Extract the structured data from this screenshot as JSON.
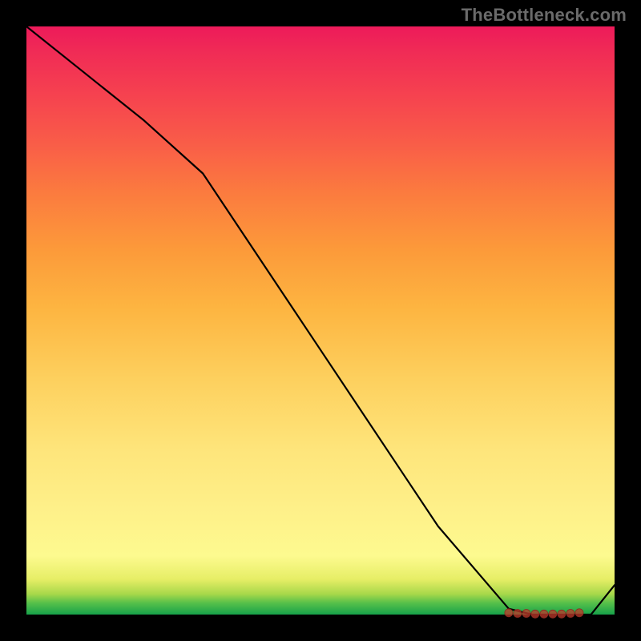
{
  "watermark": "TheBottleneck.com",
  "chart_data": {
    "type": "line",
    "title": "",
    "xlabel": "",
    "ylabel": "",
    "x": [
      0.0,
      0.1,
      0.2,
      0.3,
      0.5,
      0.7,
      0.82,
      0.86,
      0.9,
      0.93,
      0.96,
      1.0
    ],
    "values": [
      1.0,
      0.92,
      0.84,
      0.75,
      0.45,
      0.15,
      0.01,
      0.0,
      0.0,
      0.0,
      0.0,
      0.05
    ],
    "series": [
      {
        "name": "curve",
        "x": [
          0.0,
          0.1,
          0.2,
          0.3,
          0.5,
          0.7,
          0.82,
          0.86,
          0.9,
          0.93,
          0.96,
          1.0
        ],
        "y": [
          1.0,
          0.92,
          0.84,
          0.75,
          0.45,
          0.15,
          0.01,
          0.0,
          0.0,
          0.0,
          0.0,
          0.05
        ]
      }
    ],
    "markers": {
      "name": "optimum-region",
      "x": [
        0.82,
        0.835,
        0.85,
        0.865,
        0.88,
        0.895,
        0.91,
        0.925,
        0.94
      ],
      "y": [
        0.003,
        0.002,
        0.002,
        0.001,
        0.001,
        0.001,
        0.001,
        0.002,
        0.003
      ]
    },
    "xlim": [
      0,
      1
    ],
    "ylim": [
      0,
      1
    ],
    "legend": false,
    "grid": false,
    "background": "rainbow-vertical-gradient"
  }
}
